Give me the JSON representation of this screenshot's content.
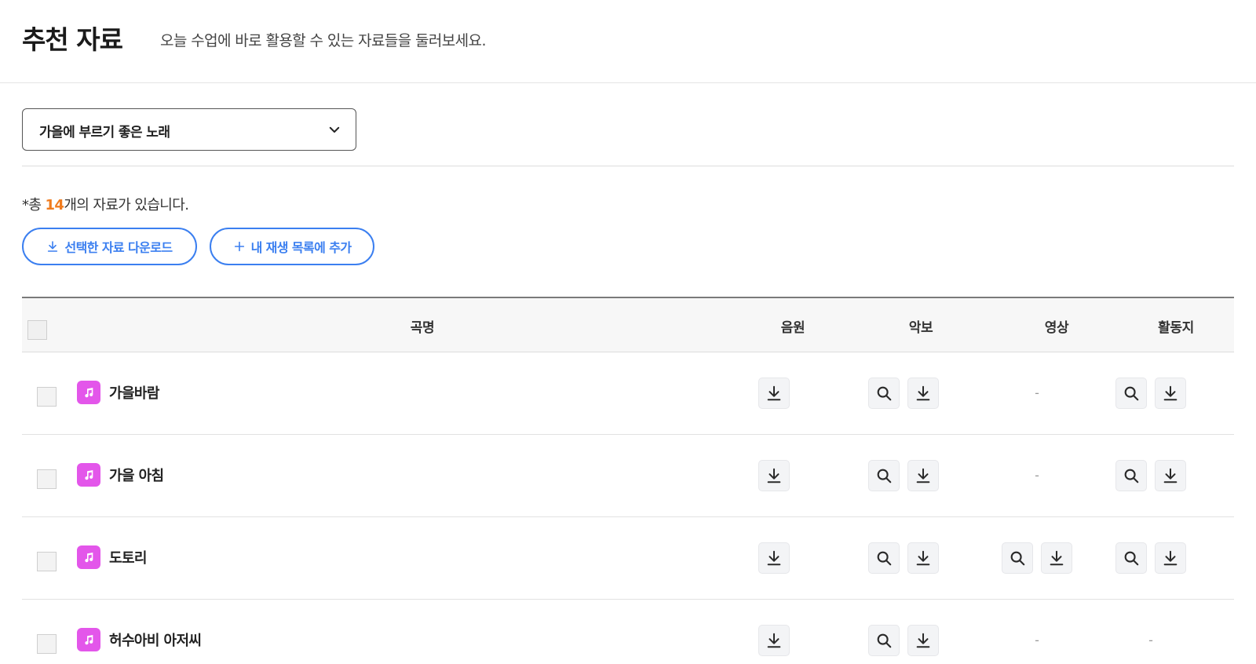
{
  "header": {
    "title": "추천 자료",
    "subtitle": "오늘 수업에 바로 활용할 수 있는 자료들을 둘러보세요."
  },
  "filter": {
    "selected": "가을에 부르기 좋은 노래"
  },
  "summary": {
    "prefix": "*총 ",
    "count": "14",
    "suffix": "개의 자료가 있습니다."
  },
  "actions": {
    "download_selected": "선택한 자료 다운로드",
    "add_to_playlist": "내 재생 목록에 추가"
  },
  "table": {
    "columns": {
      "title": "곡명",
      "audio": "음원",
      "score": "악보",
      "video": "영상",
      "worksheet": "활동지"
    },
    "empty_mark": "-",
    "rows": [
      {
        "title": "가을바람",
        "audio": true,
        "score": true,
        "video": false,
        "worksheet": true
      },
      {
        "title": "가을 아침",
        "audio": true,
        "score": true,
        "video": false,
        "worksheet": true
      },
      {
        "title": "도토리",
        "audio": true,
        "score": true,
        "video": true,
        "worksheet": true
      },
      {
        "title": "허수아비 아저씨",
        "audio": true,
        "score": true,
        "video": false,
        "worksheet": false
      }
    ]
  },
  "icons": {
    "select_chevron": "chevron-down-icon",
    "download": "download-icon",
    "preview": "search-icon",
    "add": "plus-icon",
    "song": "music-note-icon"
  },
  "colors": {
    "accent_blue": "#3b7ff0",
    "count_orange": "#f07c1f",
    "music_badge": "#e356ea"
  }
}
